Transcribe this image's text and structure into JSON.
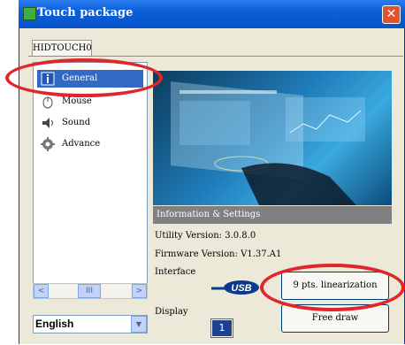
{
  "window": {
    "title": "Touch package",
    "close_glyph": "✕"
  },
  "tab": {
    "label": "HIDTOUCH0"
  },
  "sidebar": {
    "items": [
      {
        "label": "General",
        "icon": "info-book-icon",
        "selected": true
      },
      {
        "label": "Mouse",
        "icon": "mouse-icon",
        "selected": false
      },
      {
        "label": "Sound",
        "icon": "speaker-icon",
        "selected": false
      },
      {
        "label": "Advance",
        "icon": "gear-icon",
        "selected": false
      }
    ],
    "scroll_left": "<",
    "scroll_right": ">",
    "scroll_grip": "III"
  },
  "language": {
    "selected": "English",
    "chevron": "▼"
  },
  "info": {
    "header": "Information & Settings",
    "utility_version": "Utility Version: 3.0.8.0",
    "firmware_version": "Firmware Version: V1.37.A1",
    "interface_label": "Interface",
    "interface_value": "USB",
    "display_label": "Display",
    "display_value": "1"
  },
  "buttons": {
    "linearization": "9 pts. linearization",
    "free_draw": "Free draw"
  },
  "colors": {
    "title_bar": "#0a5fd8",
    "selection": "#316ac5",
    "highlight_ring": "#e0262a"
  }
}
